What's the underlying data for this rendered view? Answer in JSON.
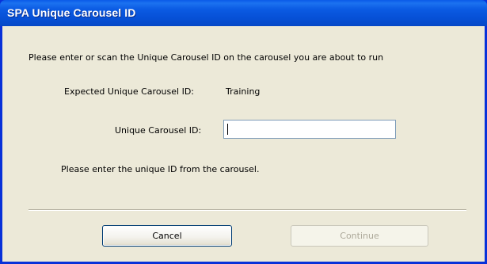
{
  "window": {
    "title": "SPA Unique Carousel ID"
  },
  "dialog": {
    "instruction": "Please enter or scan the Unique Carousel ID on the carousel you are about to run",
    "expected_label": "Expected Unique Carousel ID:",
    "expected_value": "Training",
    "id_label": "Unique Carousel ID:",
    "id_value": "",
    "hint": "Please enter the unique ID from the carousel."
  },
  "buttons": {
    "cancel_label": "Cancel",
    "continue_label": "Continue",
    "continue_enabled": false
  },
  "colors": {
    "titlebar": "#0a5ae8",
    "client_background": "#ece9d8",
    "disabled_text": "#aca899"
  }
}
